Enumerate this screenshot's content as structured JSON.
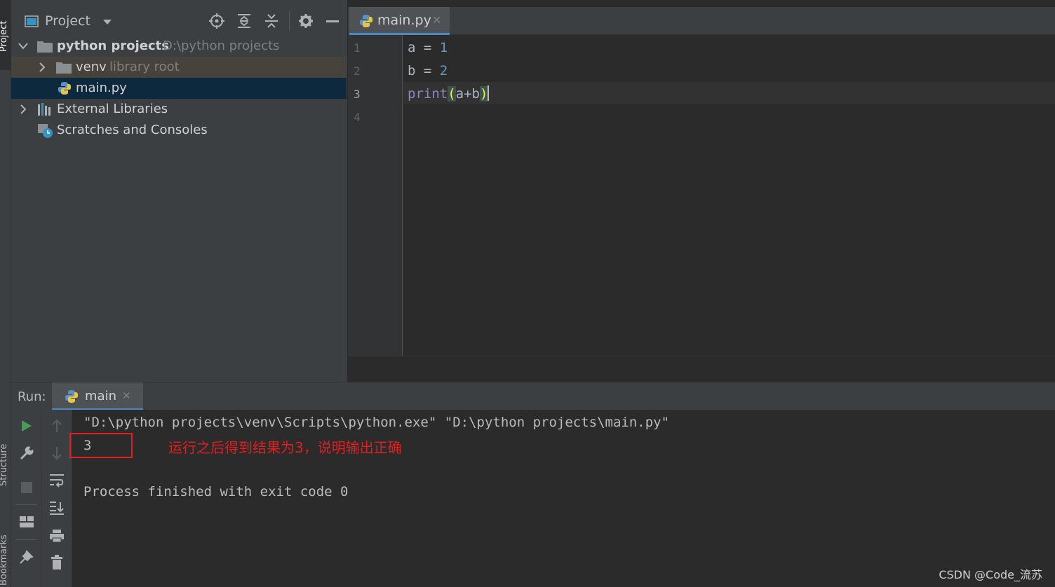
{
  "left_stripe": {
    "tabs": [
      "Project",
      "Structure",
      "Bookmarks"
    ]
  },
  "project_panel": {
    "title": "Project",
    "tree": [
      {
        "name": "python projects",
        "path": "D:\\python projects"
      },
      {
        "name": "venv",
        "note": "library root"
      },
      {
        "name": "main.py"
      },
      {
        "name": "External Libraries"
      },
      {
        "name": "Scratches and Consoles"
      }
    ]
  },
  "editor": {
    "tab_label": "main.py",
    "line_numbers": [
      "1",
      "2",
      "3",
      "4"
    ],
    "lines": {
      "l1": {
        "var": "a",
        "op": " = ",
        "num": "1"
      },
      "l2": {
        "var": "b",
        "op": " = ",
        "num": "2"
      },
      "l3": {
        "fn": "print",
        "open": "(",
        "args": "a+b",
        "close": ")"
      }
    }
  },
  "run": {
    "label": "Run:",
    "tab_label": "main",
    "console": {
      "command": "\"D:\\python projects\\venv\\Scripts\\python.exe\" \"D:\\python projects\\main.py\"",
      "output": "3",
      "annotation": "运行之后得到结果为3，说明输出正确",
      "finish": "Process finished with exit code 0"
    }
  },
  "watermark": "CSDN @Code_流苏",
  "colors": {
    "keyword_builtin": "#8888c6",
    "number": "#6897bb",
    "bracket_match": "#ffef28",
    "annotation_red": "#e02020",
    "selection": "#0d293e",
    "run_green": "#499c54"
  }
}
